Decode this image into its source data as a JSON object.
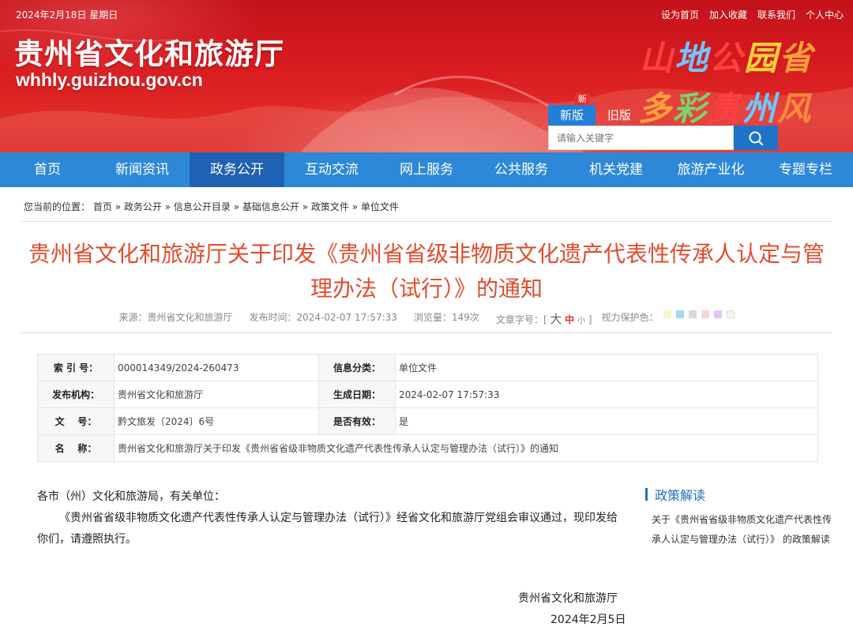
{
  "header": {
    "date": "2024年2月18日  星期日",
    "top_links": [
      "设为首页",
      "加入收藏",
      "联系我们",
      "个人中心"
    ],
    "site_title": "贵州省文化和旅游厅",
    "site_domain": "whhly.guizhou.gov.cn",
    "slogan_line1": [
      "山",
      "地",
      "公",
      "园",
      "省"
    ],
    "slogan_line2": [
      "多",
      "彩",
      "贵",
      "州",
      "风"
    ],
    "version_new": "新版",
    "version_old": "旧版",
    "new_badge": "新",
    "search_placeholder": "请输入关键字"
  },
  "nav": {
    "items": [
      "首页",
      "新闻资讯",
      "政务公开",
      "互动交流",
      "网上服务",
      "公共服务",
      "机关党建",
      "旅游产业化",
      "专题专栏"
    ],
    "active_index": 2
  },
  "breadcrumb": {
    "prefix": "您当前的位置：",
    "items": [
      "首页",
      "政务公开",
      "信息公开目录",
      "基础信息公开",
      "政策文件",
      "单位文件"
    ],
    "separator": "»"
  },
  "article": {
    "title": "贵州省文化和旅游厅关于印发《贵州省省级非物质文化遗产代表性传承人认定与管理办法（试行）》的通知",
    "source": "来源：贵州省文化和旅游厅",
    "publish_time": "发布时间：2024-02-07 17:57:33",
    "views": "浏览量：149次",
    "font_label": "文章字号：[",
    "font_big": "大",
    "font_mid": "中",
    "font_small": "小",
    "font_close": "]",
    "eye_label": "视力保护色：",
    "eye_colors": [
      "#faf5c8",
      "#aad8f2",
      "#d8d8d8",
      "#f8d4dc",
      "#dfc8f5",
      "#f5f5f5"
    ]
  },
  "info": {
    "index_label": "索 引 号：",
    "index_value": "000014349/2024-260473",
    "category_label": "信息分类：",
    "category_value": "单位文件",
    "org_label": "发布机构：",
    "org_value": "贵州省文化和旅游厅",
    "date_label": "生成日期：",
    "date_value": "2024-02-07 17:57:33",
    "docno_label": "文    号：",
    "docno_value": "黔文旅发〔2024〕6号",
    "valid_label": "是否有效：",
    "valid_value": "是",
    "name_label": "名    称：",
    "name_value": "贵州省文化和旅游厅关于印发《贵州省省级非物质文化遗产代表性传承人认定与管理办法（试行）》的通知"
  },
  "body": {
    "salutation": "各市（州）文化和旅游局，有关单位：",
    "paragraph": "《贵州省省级非物质文化遗产代表性传承人认定与管理办法（试行）》经省文化和旅游厅党组会审议通过，现印发给你们，请遵照执行。",
    "signature": "贵州省文化和旅游厅",
    "sign_date": "2024年2月5日"
  },
  "sidebar": {
    "heading": "政策解读",
    "link": "关于《贵州省省级非物质文化遗产代表性传承人认定与管理办法（试行）》 的政策解读"
  },
  "colors": {
    "header_red": "#d81c20",
    "nav_blue": "#2d88d8",
    "nav_active": "#1f62b3",
    "title_red": "#e24d2f",
    "accent_blue": "#1f6fc5"
  }
}
